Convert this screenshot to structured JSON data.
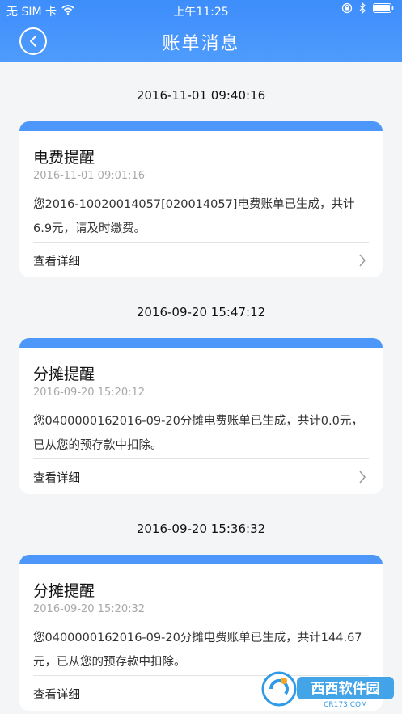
{
  "status_bar": {
    "carrier": "无 SIM 卡",
    "time": "上午11:25"
  },
  "header": {
    "title": "账单消息"
  },
  "messages": [
    {
      "timestamp": "2016-11-01 09:40:16",
      "title": "电费提醒",
      "date": "2016-11-01 09:01:16",
      "line1": "您2016-10020014057[020014057]电费账单已生成，共计",
      "line2": "6.9元，请及时缴费。",
      "link_label": "查看详细"
    },
    {
      "timestamp": "2016-09-20 15:47:12",
      "title": "分摊提醒",
      "date": "2016-09-20 15:20:12",
      "line1": "您0400000162016-09-20分摊电费账单已生成，共计0.0元，",
      "line2": "已从您的预存款中扣除。",
      "link_label": "查看详细"
    },
    {
      "timestamp": "2016-09-20 15:36:32",
      "title": "分摊提醒",
      "date": "2016-09-20 15:20:32",
      "line1": "您0400000162016-09-20分摊电费账单已生成，共计144.67",
      "line2": "元，已从您的预存款中扣除。",
      "link_label": "查看详细"
    }
  ],
  "watermark": {
    "text": "西西软件园",
    "url_text": "CR173.COM"
  },
  "colors": {
    "accent": "#4d97fb",
    "background": "#f4f5f7"
  }
}
